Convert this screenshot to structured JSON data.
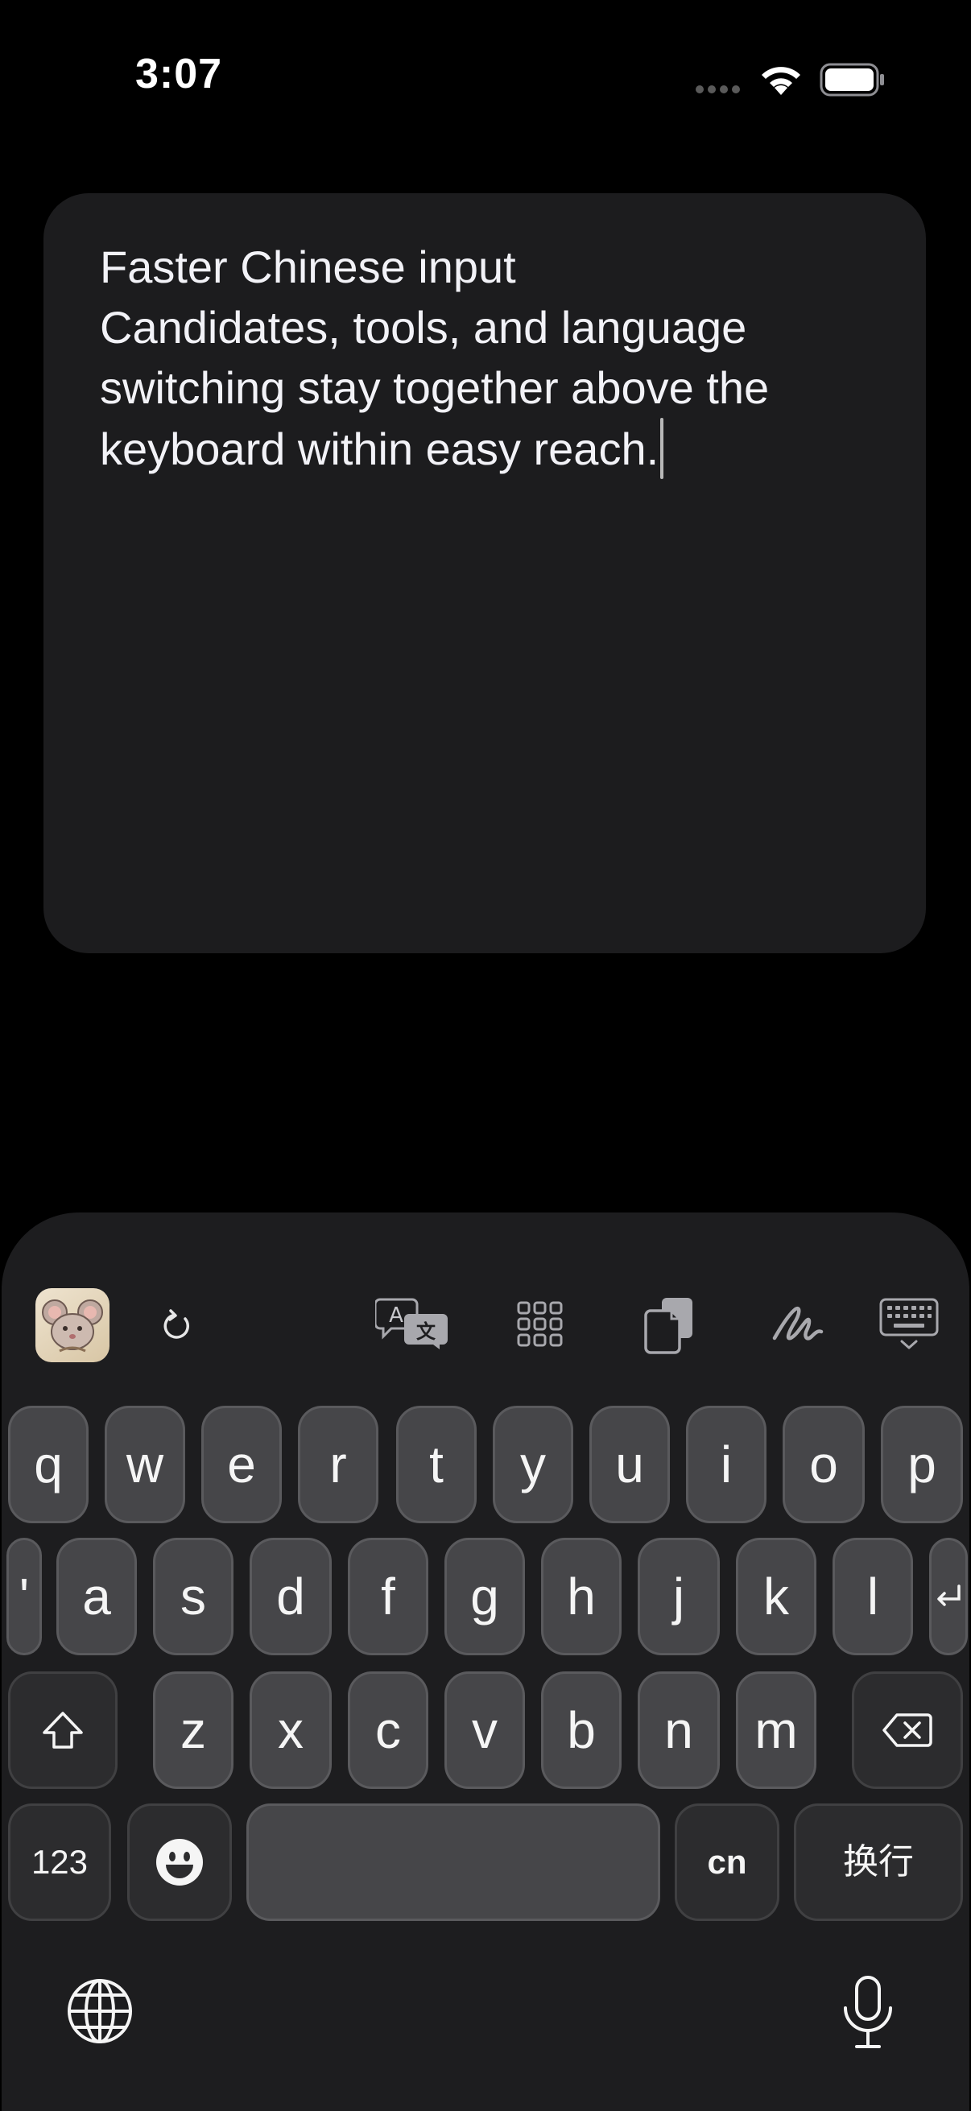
{
  "status_bar": {
    "time": "3:07"
  },
  "editor": {
    "lines": [
      "Faster Chinese input",
      "Candidates, tools, and language",
      "switching stay together above the",
      "keyboard within easy reach."
    ]
  },
  "toolbar": {
    "icons": [
      "app-logo",
      "refresh-icon",
      "translate-icon",
      "grid-icon",
      "clipboard-icon",
      "handwriting-icon",
      "keyboard-hide-icon"
    ]
  },
  "keyboard": {
    "row1": [
      "q",
      "w",
      "e",
      "r",
      "t",
      "y",
      "u",
      "i",
      "o",
      "p"
    ],
    "row2": [
      "'",
      "a",
      "s",
      "d",
      "f",
      "g",
      "h",
      "j",
      "k",
      "l"
    ],
    "row3": [
      "z",
      "x",
      "c",
      "v",
      "b",
      "n",
      "m"
    ],
    "numbers_label": "123",
    "language_label": "cn",
    "return_label": "换行"
  },
  "colors": {
    "background": "#000000",
    "card": "#1c1c1e",
    "keyboard": "#1d1d1f",
    "key": "#464649",
    "key_function": "#2c2c2e"
  }
}
